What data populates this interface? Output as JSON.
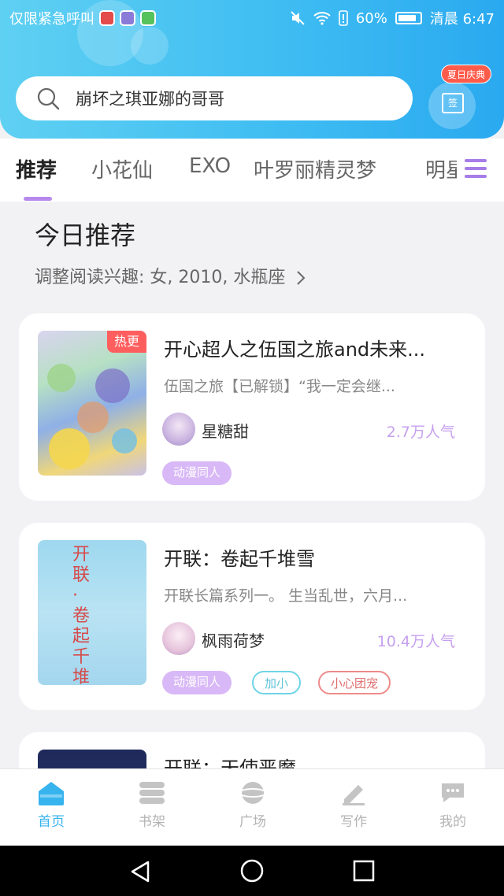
{
  "status_bar": {
    "carrier": "仅限紧急呼叫",
    "battery": "60%",
    "time": "清晨 6:47",
    "app_icon_colors": [
      "#e44b4b",
      "#8a7bd8",
      "#55c25c"
    ]
  },
  "header": {
    "search_placeholder": "崩坏之琪亚娜的哥哥",
    "gift_badge": "夏日庆典",
    "gift_label": "签",
    "accent_color": "#3fbdf2"
  },
  "tabs": [
    "推荐",
    "小花仙",
    "EXO",
    "叶罗丽精灵梦",
    "明星"
  ],
  "section": {
    "title": "今日推荐",
    "subtitle": "调整阅读兴趣: 女, 2010, 水瓶座"
  },
  "cards": [
    {
      "title": "开心超人之伍国之旅and未来...",
      "description": "伍国之旅【已解锁】“我一定会继...",
      "author": "星糖甜",
      "popularity": "2.7万人气",
      "badge": "热更",
      "tags": [
        "动漫同人"
      ]
    },
    {
      "title": "开联：卷起千堆雪",
      "description": "开联长篇系列一。 生当乱世，六月...",
      "author": "枫雨荷梦",
      "popularity": "10.4万人气",
      "cover_text": "开联·卷起千堆雪",
      "tags": [
        "动漫同人",
        "加小",
        "小心团宠"
      ]
    },
    {
      "title": "开联：天使恶魔"
    }
  ],
  "bottom_nav": [
    {
      "label": "首页",
      "icon": "home-icon",
      "active": true
    },
    {
      "label": "书架",
      "icon": "bookshelf-icon",
      "active": false
    },
    {
      "label": "广场",
      "icon": "planet-icon",
      "active": false
    },
    {
      "label": "写作",
      "icon": "pen-icon",
      "active": false
    },
    {
      "label": "我的",
      "icon": "chat-bubble-icon",
      "active": false
    }
  ],
  "colors": {
    "tab_indicator": "#b789ec",
    "popularity": "#c6a1ef",
    "nav_active": "#37b3ee",
    "hot_badge": "#ff5e5e"
  }
}
